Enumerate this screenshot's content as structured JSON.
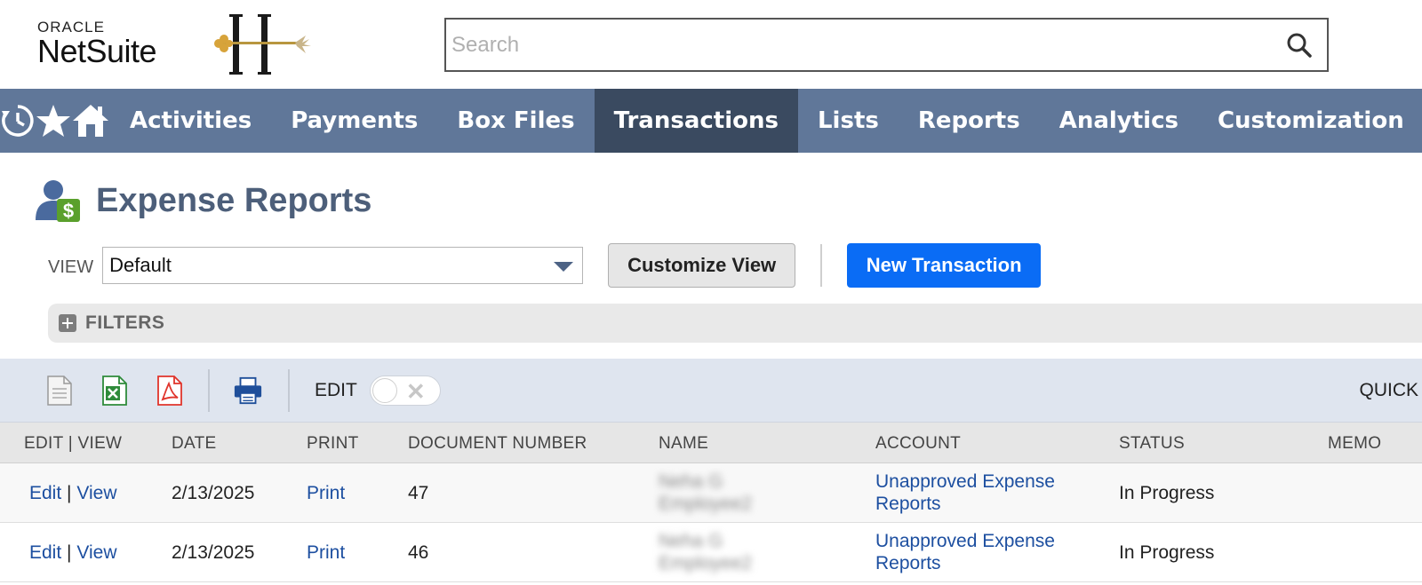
{
  "header": {
    "oracle_text": "ORACLE",
    "netsuite_text": "NetSuite",
    "search_placeholder": "Search"
  },
  "nav": {
    "icons": [
      "recent-icon",
      "star-icon",
      "home-icon"
    ],
    "items": [
      {
        "label": "Activities"
      },
      {
        "label": "Payments"
      },
      {
        "label": "Box Files"
      },
      {
        "label": "Transactions",
        "active": true
      },
      {
        "label": "Lists"
      },
      {
        "label": "Reports"
      },
      {
        "label": "Analytics"
      },
      {
        "label": "Customization"
      }
    ]
  },
  "page": {
    "title": "Expense Reports"
  },
  "view": {
    "label": "VIEW",
    "selected": "Default",
    "customize_label": "Customize View",
    "new_label": "New Transaction"
  },
  "filters": {
    "label": "FILTERS"
  },
  "toolbar": {
    "edit_label": "EDIT",
    "quick_label": "QUICK"
  },
  "table": {
    "columns": [
      "EDIT | VIEW",
      "DATE",
      "PRINT",
      "DOCUMENT NUMBER",
      "NAME",
      "ACCOUNT",
      "STATUS",
      "MEMO"
    ],
    "rows": [
      {
        "edit": "Edit",
        "sep": "|",
        "view": "View",
        "date": "2/13/2025",
        "print": "Print",
        "doc": "47",
        "name_line1": "Neha G",
        "name_line2": "Employee2",
        "account_line1": "Unapproved Expense",
        "account_line2": "Reports",
        "status": "In Progress",
        "memo": ""
      },
      {
        "edit": "Edit",
        "sep": "|",
        "view": "View",
        "date": "2/13/2025",
        "print": "Print",
        "doc": "46",
        "name_line1": "Neha G",
        "name_line2": "Employee2",
        "account_line1": "Unapproved Expense",
        "account_line2": "Reports",
        "status": "In Progress",
        "memo": ""
      }
    ]
  },
  "colors": {
    "nav_bg": "#607799",
    "nav_active": "#3a4a60",
    "primary_button": "#0a6cf5",
    "link": "#1d4fa0",
    "title": "#4d5f7a"
  }
}
